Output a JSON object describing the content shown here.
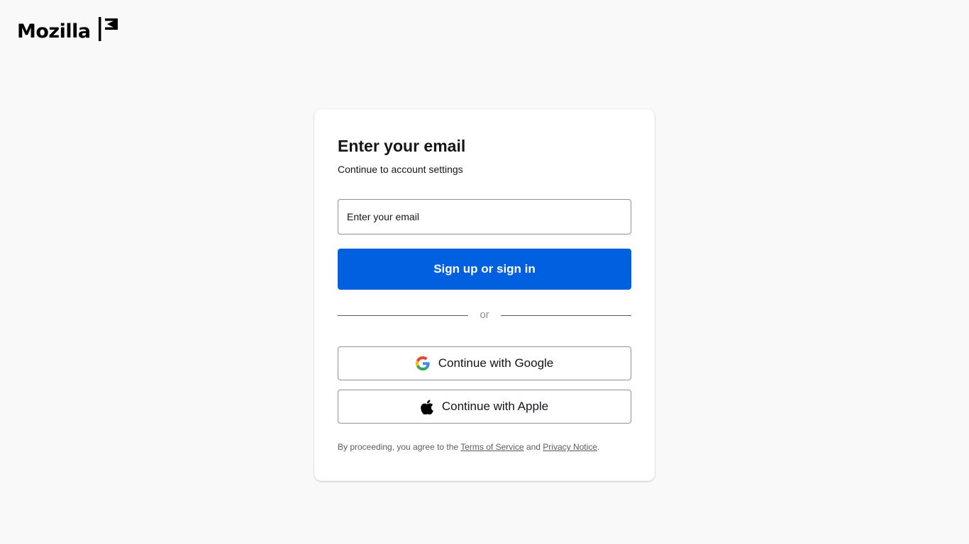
{
  "header": {
    "logo_text": "Mozilla"
  },
  "form": {
    "heading": "Enter your email",
    "subheading": "Continue to account settings",
    "email_placeholder": "Enter your email",
    "email_value": "",
    "submit_label": "Sign up or sign in",
    "divider_text": "or",
    "google_label": "Continue with Google",
    "apple_label": "Continue with Apple"
  },
  "legal": {
    "prefix": "By proceeding, you agree to the ",
    "terms_label": "Terms of Service",
    "middle": " and ",
    "privacy_label": "Privacy Notice",
    "suffix": "."
  },
  "icons": {
    "logo_mark": "mozilla-m-icon",
    "google": "google-g-icon",
    "apple": "apple-logo-icon"
  },
  "colors": {
    "primary": "#0060df",
    "background": "#f9f9fa",
    "text": "#15141a",
    "muted": "#5b5b66"
  }
}
